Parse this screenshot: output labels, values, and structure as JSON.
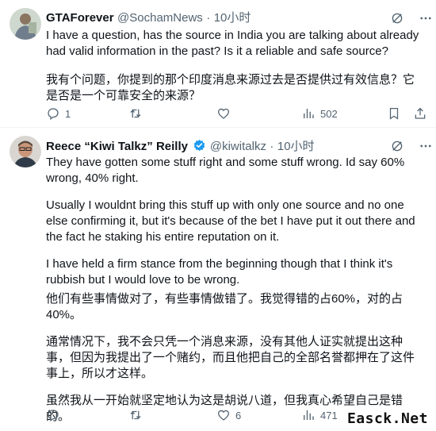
{
  "tweet1": {
    "name": "GTAForever",
    "handle": "@SochamNews",
    "separator": "·",
    "time": "10小时",
    "text_en": "I have a question, has the source in India you are talking about already had valid information in the past? Is it a reliable and safe source?",
    "text_zh": "我有个问题，你提到的那个印度消息来源过去是否提供过有效信息？它是否是一个可靠安全的来源？",
    "replies": "1",
    "retweets": "",
    "likes": "",
    "views": "502"
  },
  "tweet2": {
    "name": "Reece “Kiwi Talkz” Reilly",
    "handle": "@kiwitalkz",
    "separator": "·",
    "time": "10小时",
    "paragraphs_en": [
      "They have gotten some stuff right and some stuff wrong. Id say 60% wrong, 40% right.",
      "Usually I wouldnt bring this stuff up with only one source and no one else confirming it, but it's because of the bet I have put it out there and the fact he staking his entire reputation on it.",
      "I have held a firm stance from the beginning though that I think it's rubbish but I would love to be wrong."
    ],
    "paragraphs_zh": [
      "他们有些事情做对了，有些事情做错了。我觉得错的占60%，对的占40%。",
      "通常情况下，我不会只凭一个消息来源，没有其他人证实就提出这种事，但因为我提出了一个赌约，而且他把自己的全部名誉都押在了这件事上，所以才这样。",
      "虽然我从一开始就坚定地认为这是胡说八道，但我真心希望自己是错的。"
    ],
    "replies": "",
    "retweets": "",
    "likes": "6",
    "views": "471"
  },
  "watermark": "Easck.Net",
  "colors": {
    "text": "#0f1419",
    "muted": "#536471",
    "verified": "#1d9bf0"
  }
}
